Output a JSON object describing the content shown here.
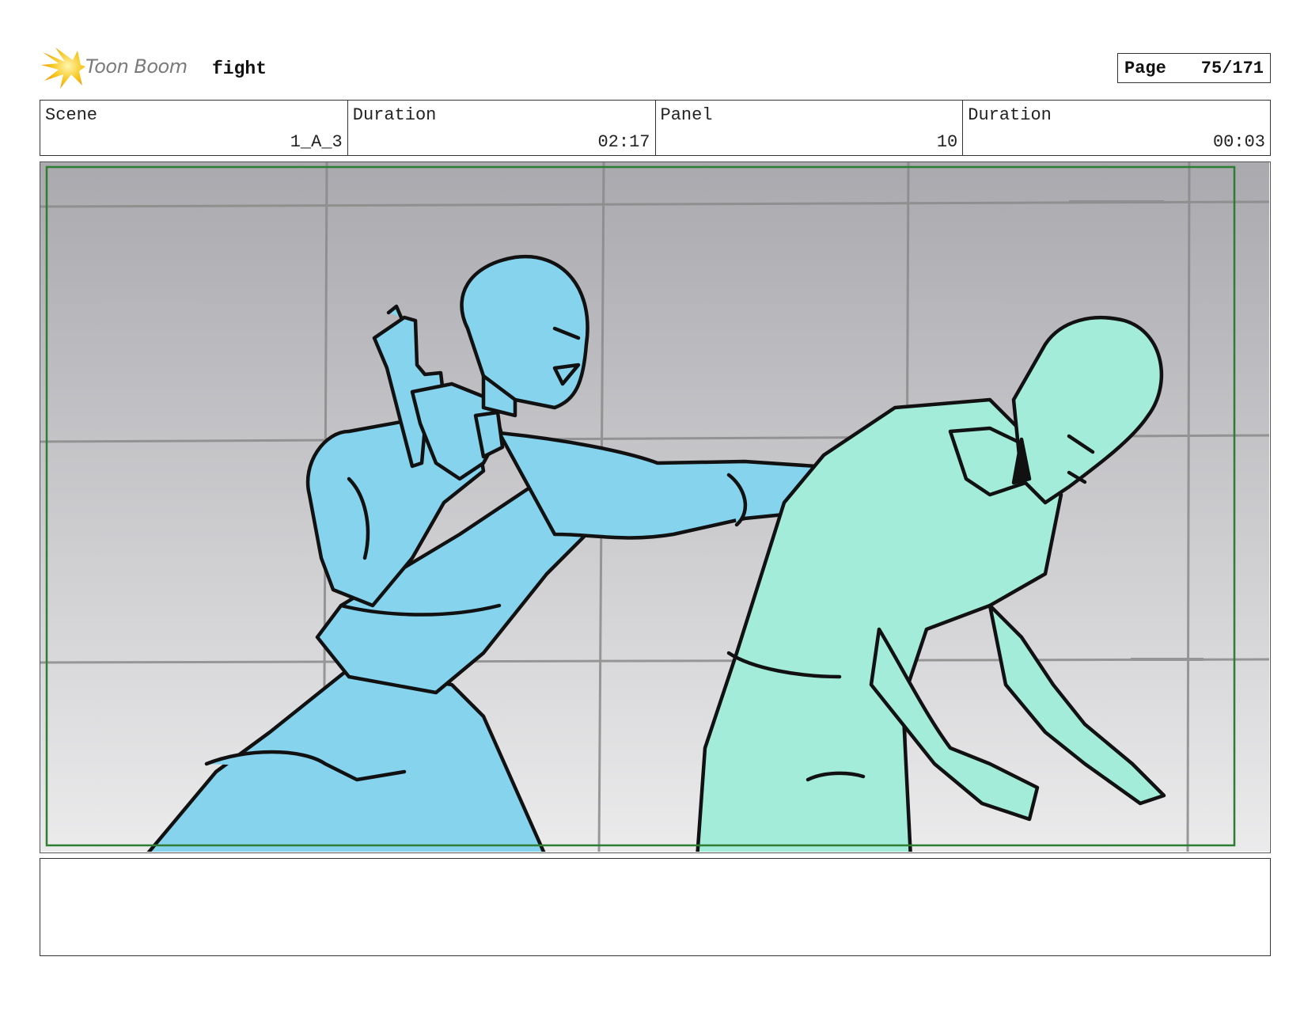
{
  "header": {
    "brand": "Toon Boom",
    "project_title": "fight",
    "page_label": "Page",
    "page_value": "75/171"
  },
  "info": [
    {
      "label": "Scene",
      "value": "1_A_3"
    },
    {
      "label": "Duration",
      "value": "02:17"
    },
    {
      "label": "Panel",
      "value": "10"
    },
    {
      "label": "Duration",
      "value": "00:03"
    }
  ],
  "colors": {
    "figure_left": "#86d3ee",
    "figure_right": "#a2ecd9",
    "safe_frame": "#2e7d32",
    "grid": "#8a8a8a",
    "logo_yellow": "#f7c51a"
  },
  "notes": {
    "text": ""
  }
}
